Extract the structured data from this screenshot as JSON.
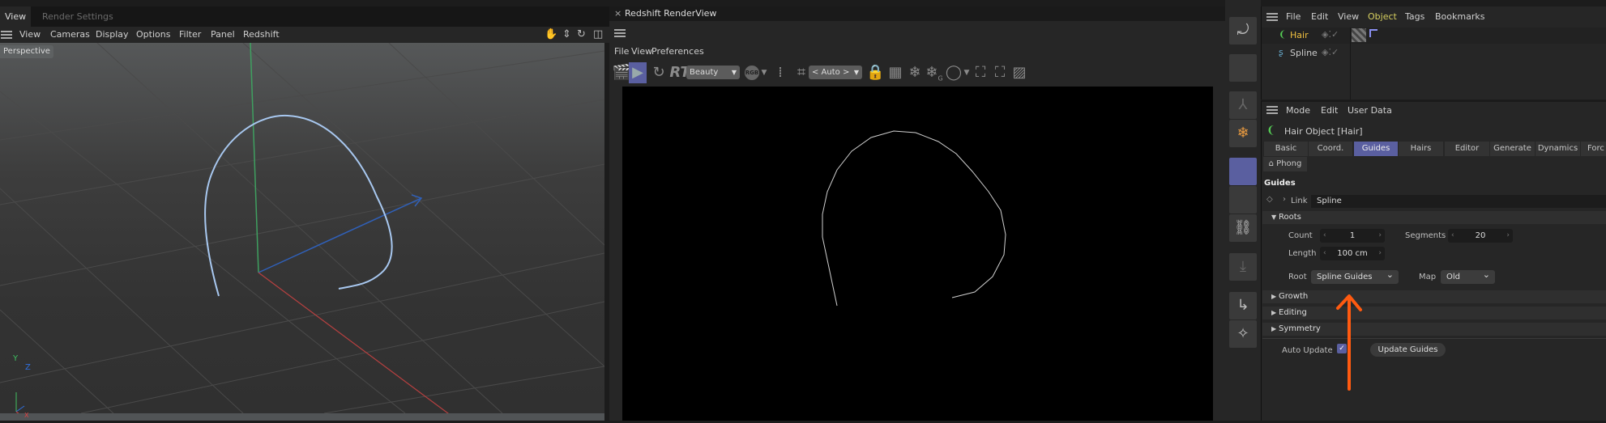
{
  "viewport": {
    "tabs": [
      {
        "label": "View"
      },
      {
        "label": "Render Settings"
      }
    ],
    "menu": [
      "View",
      "Cameras",
      "Display",
      "Options",
      "Filter",
      "Panel",
      "Redshift"
    ],
    "camera_label": "Perspective",
    "axis_labels": {
      "y": "Y",
      "z": "Z",
      "x": "X"
    }
  },
  "renderview": {
    "title": "Redshift RenderView",
    "menu": [
      "File",
      "View",
      "Preferences"
    ],
    "toolbar": {
      "rt_label": "RT",
      "aov": "Beauty",
      "rgb_label": "RGB",
      "crop_mode": "< Auto >",
      "snow_g_label": "G"
    }
  },
  "object_manager": {
    "menu": [
      "File",
      "Edit",
      "View",
      "Object",
      "Tags",
      "Bookmarks"
    ],
    "objects": [
      {
        "name": "Hair",
        "active": true
      },
      {
        "name": "Spline",
        "active": false
      }
    ]
  },
  "attributes": {
    "menu": [
      "Mode",
      "Edit",
      "User Data"
    ],
    "object_title": "Hair Object [Hair]",
    "tabs": [
      "Basic",
      "Coord.",
      "Guides",
      "Hairs",
      "Editor",
      "Generate",
      "Dynamics",
      "Forc"
    ],
    "active_tab": "Guides",
    "subtab": "Phong",
    "section": "Guides",
    "link_label": "Link",
    "link_value": "Spline",
    "roots": {
      "header": "Roots",
      "count_label": "Count",
      "count": "1",
      "segments_label": "Segments",
      "segments": "20",
      "length_label": "Length",
      "length": "100 cm",
      "root_label": "Root",
      "root": "Spline Guides",
      "map_label": "Map",
      "map": "Old"
    },
    "groups": [
      "Growth",
      "Editing",
      "Symmetry"
    ],
    "auto_update_label": "Auto Update",
    "auto_update": true,
    "update_button": "Update Guides"
  },
  "colors": {
    "accent": "#5a5fa0",
    "active_object": "#f0c040",
    "annotation": "#ff5a10"
  }
}
